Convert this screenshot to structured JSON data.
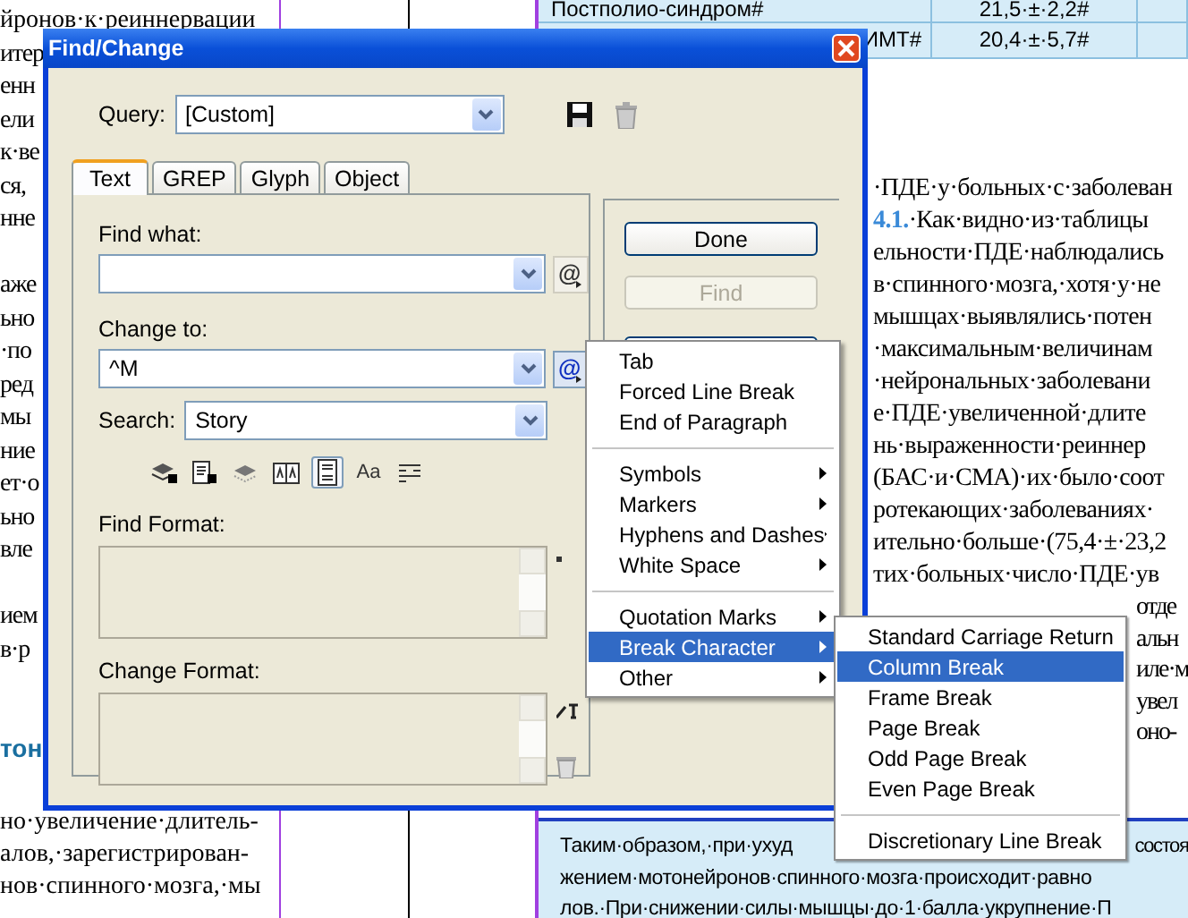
{
  "document": {
    "left_column": {
      "top_line": "йронов·к·реиннервации",
      "fragment_groups": [
        [
          "итер",
          "енн",
          "ели",
          "к·ве",
          "ся,",
          "нне"
        ],
        [
          "аже",
          "ьно",
          "·по",
          "ред",
          "мы",
          "ние",
          "ет·о",
          "ьно",
          "вле"
        ],
        [
          "ием",
          "в·р"
        ]
      ],
      "heading": "тон",
      "bottom_lines": [
        "но·увеличение·длитель-",
        "алов,·зарегистрирован-",
        "нов·спинного·мозга,·мы"
      ]
    },
    "table": {
      "rows": [
        {
          "cells": [
            "Постполио-синдром#",
            "21,5·±·2,2#"
          ]
        },
        {
          "cells": [
            "ИМТ#",
            "20,4·±·5,7#"
          ]
        }
      ]
    },
    "right_column": {
      "lines": [
        {
          "text": "·ПДЕ·у·больных·с·заболеван"
        },
        {
          "ref": "4.1.",
          "text": "·Как·видно·из·таблицы"
        },
        {
          "text": "ельности·ПДЕ·наблюдались"
        },
        {
          "text": "в·спинного·мозга,·хотя·у·не"
        },
        {
          "text": "мышцах·выявлялись·потен"
        },
        {
          "text": "·максимальным·величинам"
        },
        {
          "text": "·нейрональных·заболевани"
        },
        {
          "text": "е·ПДЕ·увеличенной·длите"
        },
        {
          "text": "нь·выраженности·реиннер"
        },
        {
          "text": "(БАС·и·СМА)·их·было·соот"
        },
        {
          "text": "ротекающих·заболеваниях·"
        },
        {
          "text": "ительно·больше·(75,4·±·23,2"
        },
        {
          "text": "тих·больных·число·ПДЕ·ув"
        }
      ],
      "lines_beside_menu": [
        "отде",
        "альн",
        "иле·м",
        "увел",
        "оно-"
      ]
    },
    "summary_box": {
      "first_line_start": "Таким·образом,·при·ухуд",
      "first_line_end": "состоя",
      "lines": [
        "жением·мотонейронов·спинного·мозга·происходит·равно",
        "лов.·При·снижении·силы·мышцы·до·1·балла·укрупнение·П"
      ]
    }
  },
  "dialog": {
    "title": "Find/Change",
    "query_label": "Query:",
    "query_value": "[Custom]",
    "tabs": [
      {
        "label": "Text",
        "selected": true
      },
      {
        "label": "GREP",
        "selected": false
      },
      {
        "label": "Glyph",
        "selected": false
      },
      {
        "label": "Object",
        "selected": false
      }
    ],
    "find_label": "Find what:",
    "find_special_symbol": "@",
    "find_special_pressed": false,
    "change_label": "Change to:",
    "change_value": "^M",
    "change_special_symbol": "@",
    "change_special_pressed": true,
    "search_label": "Search:",
    "search_value": "Story",
    "search_options": [
      {
        "kind": "locked-layers",
        "on": false
      },
      {
        "kind": "locked-stories",
        "on": false
      },
      {
        "kind": "hidden-layers",
        "on": false
      },
      {
        "kind": "master-pages",
        "on": false
      },
      {
        "kind": "footnotes",
        "on": true
      },
      {
        "kind": "case-sensitive",
        "label": "Aa",
        "on": false
      },
      {
        "kind": "whole-word",
        "on": false
      }
    ],
    "find_format_label": "Find Format:",
    "change_format_label": "Change Format:",
    "buttons": [
      {
        "label": "Done",
        "disabled": false
      },
      {
        "label": "Find",
        "disabled": true
      },
      {
        "disabled": false
      }
    ]
  },
  "insert_menu": {
    "items": [
      {
        "kind": "item",
        "label": "Tab",
        "submenu": false,
        "selected": false
      },
      {
        "kind": "item",
        "label": "Forced Line Break",
        "submenu": false,
        "selected": false
      },
      {
        "kind": "item",
        "label": "End of Paragraph",
        "submenu": false,
        "selected": false
      },
      {
        "kind": "separator"
      },
      {
        "kind": "item",
        "label": "Symbols",
        "submenu": true,
        "selected": false
      },
      {
        "kind": "item",
        "label": "Markers",
        "submenu": true,
        "selected": false
      },
      {
        "kind": "item",
        "label": "Hyphens and Dashes",
        "submenu": true,
        "selected": false
      },
      {
        "kind": "item",
        "label": "White Space",
        "submenu": true,
        "selected": false
      },
      {
        "kind": "separator"
      },
      {
        "kind": "item",
        "label": "Quotation Marks",
        "submenu": true,
        "selected": false
      },
      {
        "kind": "item",
        "label": "Break Character",
        "submenu": true,
        "selected": true
      },
      {
        "kind": "item",
        "label": "Other",
        "submenu": true,
        "selected": false
      }
    ]
  },
  "break_submenu": {
    "items": [
      {
        "kind": "item",
        "label": "Standard Carriage Return",
        "selected": false
      },
      {
        "kind": "item",
        "label": "Column Break",
        "selected": true
      },
      {
        "kind": "item",
        "label": "Frame Break",
        "selected": false
      },
      {
        "kind": "item",
        "label": "Page Break",
        "selected": false
      },
      {
        "kind": "item",
        "label": "Odd Page Break",
        "selected": false
      },
      {
        "kind": "item",
        "label": "Even Page Break",
        "selected": false
      },
      {
        "kind": "separator"
      },
      {
        "kind": "item",
        "label": "Discretionary Line Break",
        "selected": false
      }
    ]
  }
}
